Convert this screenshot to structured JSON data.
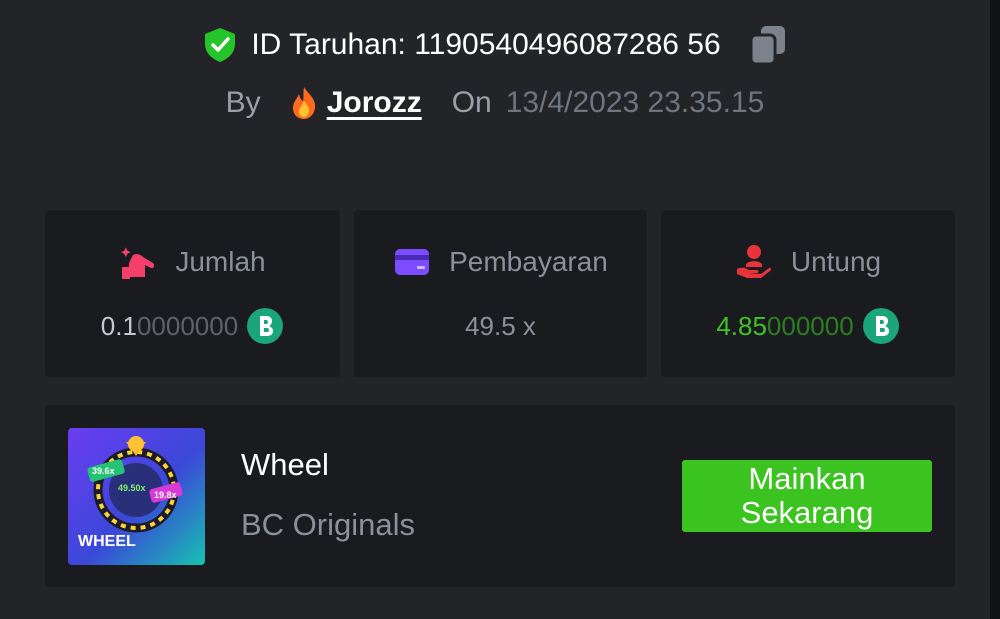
{
  "header": {
    "bet_id_label": "ID Taruhan: 1190540496087286 56",
    "by_label": "By",
    "username": "Jorozz",
    "on_label": "On",
    "datetime": "13/4/2023 23.35.15"
  },
  "stats": {
    "amount": {
      "label": "Jumlah",
      "value_main": "0.1",
      "value_trailing": "0000000"
    },
    "payout": {
      "label": "Pembayaran",
      "value": "49.5 x"
    },
    "profit": {
      "label": "Untung",
      "value_main": "4.85",
      "value_trailing": "000000"
    }
  },
  "game": {
    "title": "Wheel",
    "provider": "BC Originals",
    "thumbnail_text": "WHEEL",
    "thumb_multipliers": [
      "39.6x",
      "49.50x",
      "19.8x"
    ],
    "play_button": "Mainkan Sekarang"
  },
  "colors": {
    "background": "#232427",
    "card": "#1a1b1e",
    "accent_green": "#3bc31f",
    "profit_green": "#3fc428"
  },
  "icons": [
    "shield-check-icon",
    "copy-icon",
    "flame-icon",
    "bet-amount-icon",
    "card-icon",
    "profit-hand-icon",
    "bc-coin-icon"
  ]
}
